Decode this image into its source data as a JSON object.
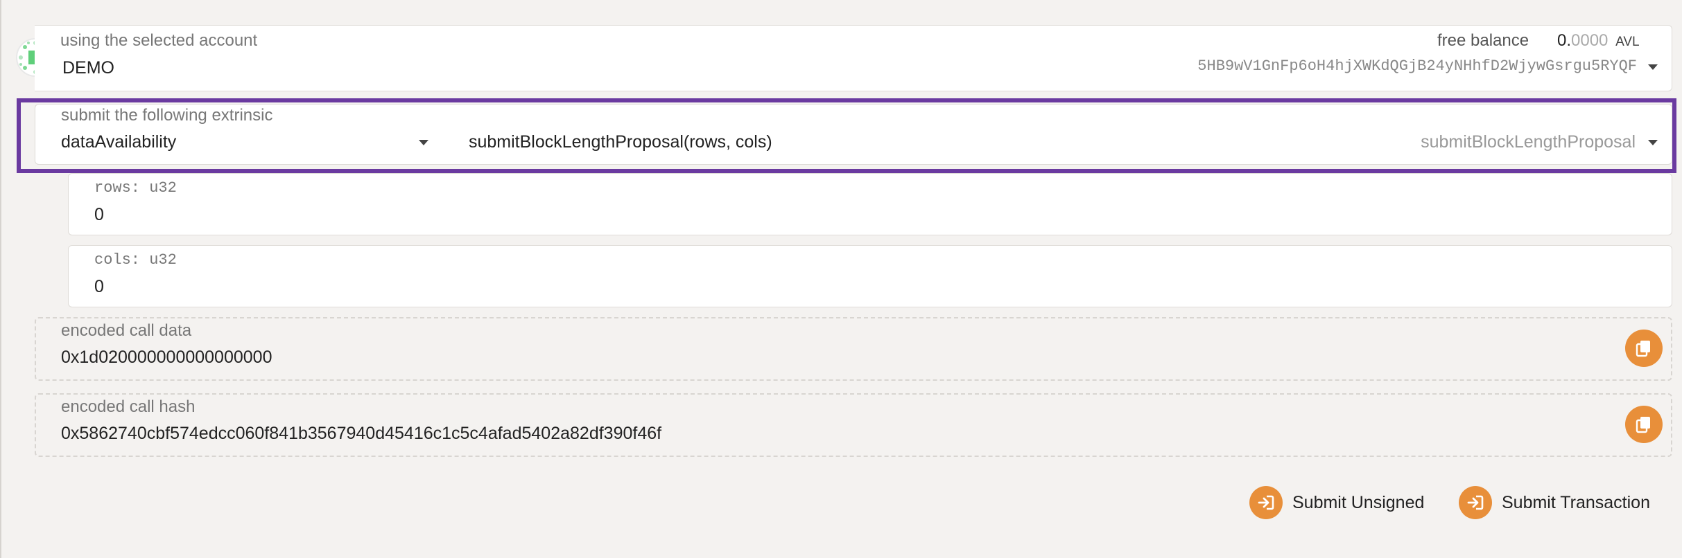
{
  "account": {
    "label": "using the selected account",
    "name": "DEMO",
    "balance_label": "free balance",
    "balance_int": "0.",
    "balance_dec": "0000",
    "balance_unit": "AVL",
    "address": "5HB9wV1GnFp6oH4hjXWKdQGjB24yNHhfD2WjywGsrgu5RYQF"
  },
  "extrinsic": {
    "label": "submit the following extrinsic",
    "section": "dataAvailability",
    "method_signature": "submitBlockLengthProposal(rows, cols)",
    "method_name": "submitBlockLengthProposal"
  },
  "params": [
    {
      "label": "rows: u32",
      "value": "0"
    },
    {
      "label": "cols: u32",
      "value": "0"
    }
  ],
  "encoded_call_data": {
    "label": "encoded call data",
    "value": "0x1d020000000000000000"
  },
  "encoded_call_hash": {
    "label": "encoded call hash",
    "value": "0x5862740cbf574edcc060f841b3567940d45416c1c5c4afad5402a82df390f46f"
  },
  "actions": {
    "submit_unsigned": "Submit Unsigned",
    "submit_transaction": "Submit Transaction"
  },
  "colors": {
    "highlight": "#6a3aa0",
    "accent": "#e88f3a"
  }
}
